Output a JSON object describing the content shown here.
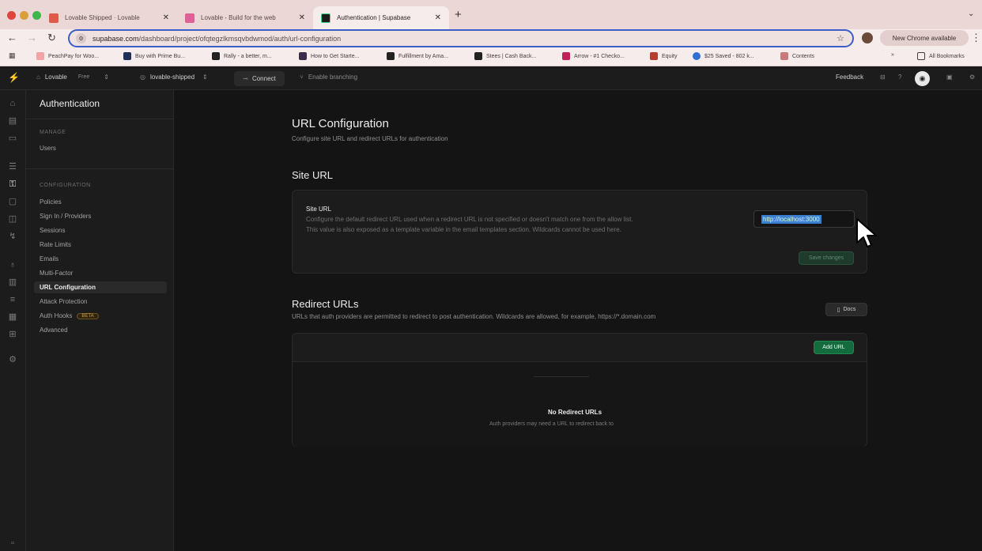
{
  "browser": {
    "tabs": [
      {
        "title": "Lovable Shipped · Lovable",
        "active": false,
        "color": "#e05a4a"
      },
      {
        "title": "Lovable - Build for the web",
        "active": false,
        "color": "#e0609a"
      },
      {
        "title": "Authentication | Supabase",
        "active": true,
        "color": "#3ecf8e"
      }
    ],
    "new_tab_label": "+",
    "url_host": "supabase.com",
    "url_path": "/dashboard/project/ofqtegzlkmsqvbdwmod/auth/url-configuration",
    "update_pill": "New Chrome available",
    "bookmarks": [
      {
        "label": "PeachPay for Woo...",
        "color": "#f3a3a3"
      },
      {
        "label": "Buy with Prime Bu...",
        "color": "#1f2f55"
      },
      {
        "label": "Rally - a better, m...",
        "color": "#222222"
      },
      {
        "label": "How to Get Starte...",
        "color": "#3b2c4c"
      },
      {
        "label": "Fulfillment by Ama...",
        "color": "#222222"
      },
      {
        "label": "Stees | Cash Back...",
        "color": "#222222"
      },
      {
        "label": "Arrow - #1 Checko...",
        "color": "#c1205a"
      },
      {
        "label": "Equity",
        "color": "#b73d2e"
      },
      {
        "label": "$25 Saved - 802 k...",
        "color": "#2f6fd6"
      },
      {
        "label": "Contents",
        "color": "#c97b7b"
      }
    ],
    "all_bookmarks": "All Bookmarks"
  },
  "app": {
    "org": "Lovable",
    "plan": "Free",
    "project": "lovable-shipped",
    "connect": "Connect",
    "branching": "Enable branching",
    "feedback": "Feedback"
  },
  "sidebar": {
    "title": "Authentication",
    "manage_header": "MANAGE",
    "manage_items": [
      "Users"
    ],
    "config_header": "CONFIGURATION",
    "config_items": [
      "Policies",
      "Sign In / Providers",
      "Sessions",
      "Rate Limits",
      "Emails",
      "Multi-Factor",
      "URL Configuration",
      "Attack Protection",
      "Auth Hooks",
      "Advanced"
    ],
    "beta_label": "BETA"
  },
  "main": {
    "title": "URL Configuration",
    "subtitle": "Configure site URL and redirect URLs for authentication",
    "site_url": {
      "heading": "Site URL",
      "label": "Site URL",
      "desc1": "Configure the default redirect URL used when a redirect URL is not specified or doesn't match one from the allow list.",
      "desc2": "This value is also exposed as a template variable in the email templates section. Wildcards cannot be used here.",
      "value": "http://localhost:3000",
      "save": "Save changes"
    },
    "redirect": {
      "heading": "Redirect URLs",
      "desc": "URLs that auth providers are permitted to redirect to post authentication. Wildcards are allowed, for example, https://*.domain.com",
      "docs": "Docs",
      "add": "Add URL",
      "empty_title": "No Redirect URLs",
      "empty_sub": "Auth providers may need a URL to redirect back to"
    }
  }
}
